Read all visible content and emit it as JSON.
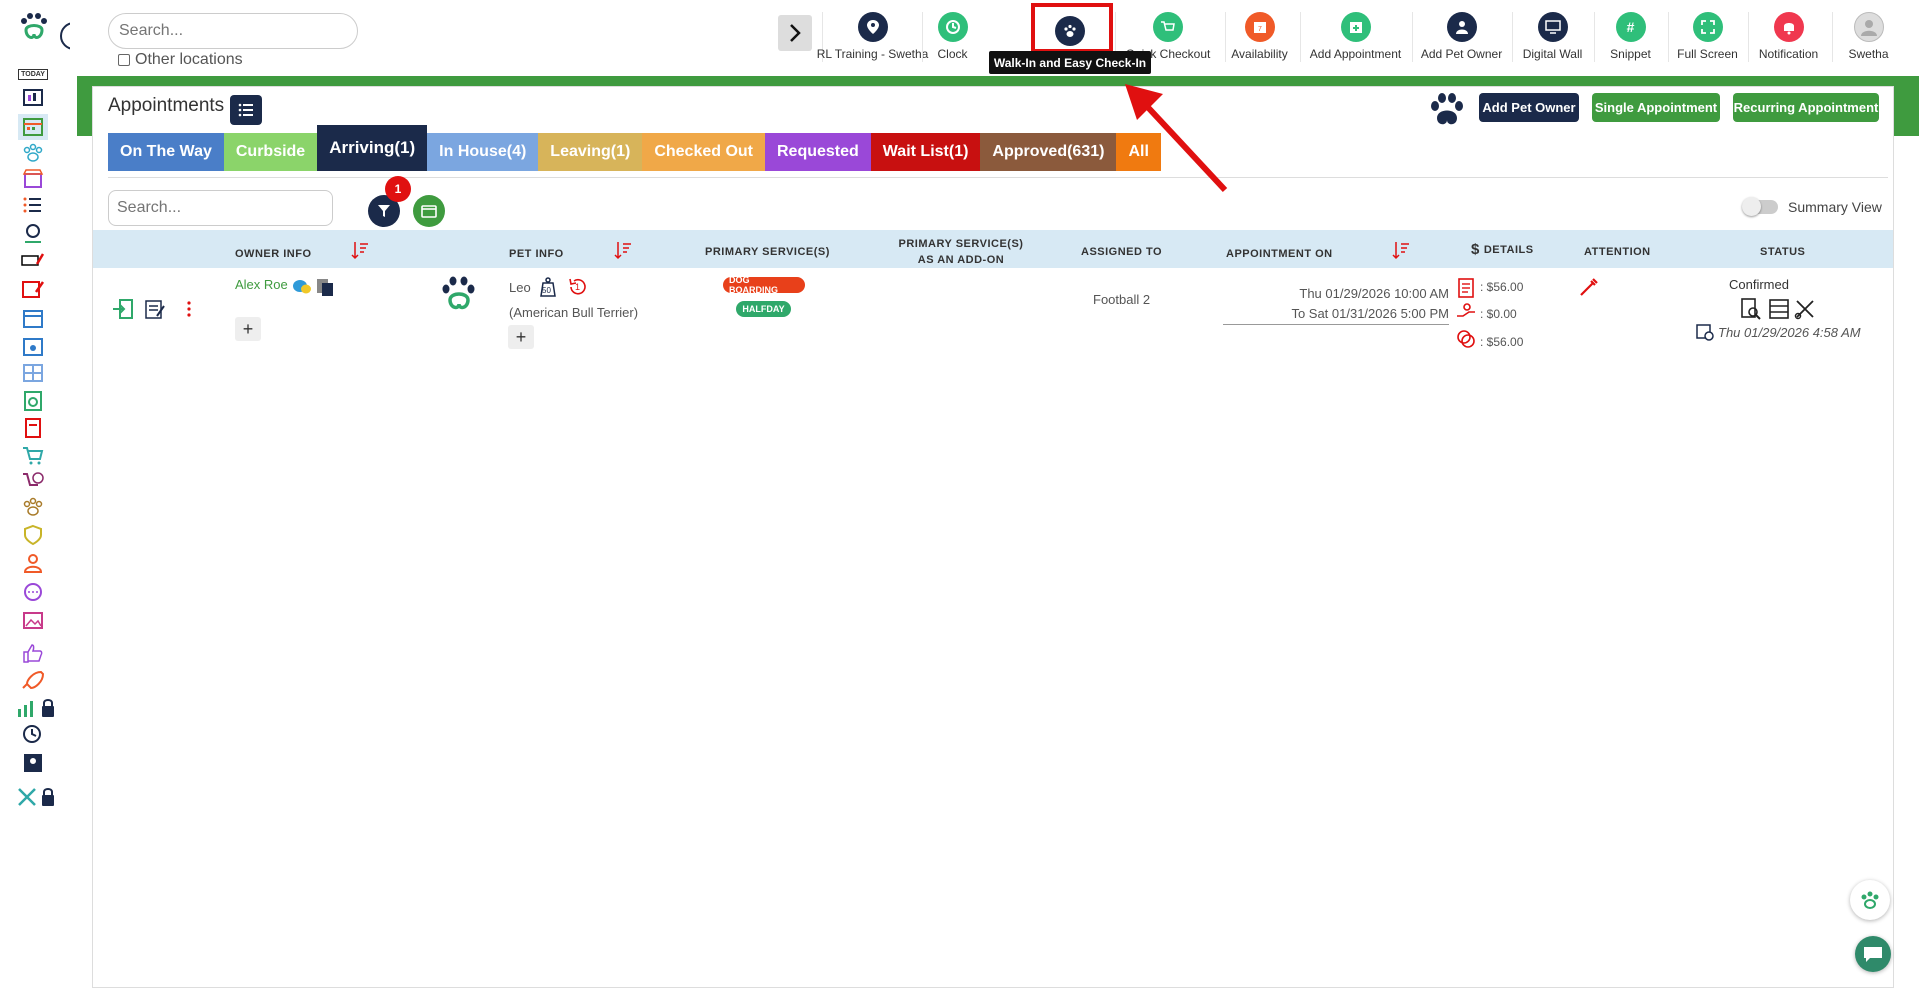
{
  "topbar": {
    "search_placeholder": "Search...",
    "other_locations": "Other locations",
    "items": [
      {
        "label": "RL Training - Swetha",
        "color": "#1b2a4a"
      },
      {
        "label": "Clock",
        "color": "#2fbf7a"
      },
      {
        "label": "",
        "color": "#1b2a4a"
      },
      {
        "label": "Quick Checkout",
        "color": "#2fbf7a"
      },
      {
        "label": "Availability",
        "color": "#f05a28"
      },
      {
        "label": "Add Appointment",
        "color": "#2fbf7a"
      },
      {
        "label": "Add Pet Owner",
        "color": "#1b2a4a"
      },
      {
        "label": "Digital Wall",
        "color": "#1b2a4a"
      },
      {
        "label": "Snippet",
        "color": "#2fbf7a"
      },
      {
        "label": "Full Screen",
        "color": "#2fbf7a"
      },
      {
        "label": "Notification",
        "color": "#f0384f"
      },
      {
        "label": "Swetha",
        "color": "#cccccc"
      }
    ],
    "tooltip": "Walk-In and Easy Check-In"
  },
  "appointments": {
    "title": "Appointments",
    "buttons": {
      "add_pet_owner": "Add Pet Owner",
      "single": "Single Appointment",
      "recurring": "Recurring Appointment"
    },
    "tabs": [
      {
        "label": "On The Way",
        "color": "#4a7ec8"
      },
      {
        "label": "Curbside",
        "color": "#8bd46a"
      },
      {
        "label": "Arriving(1)",
        "color": "#1b2a4a"
      },
      {
        "label": "In House(4)",
        "color": "#7ba6e0"
      },
      {
        "label": "Leaving(1)",
        "color": "#d7b45a"
      },
      {
        "label": "Checked Out",
        "color": "#f0a848"
      },
      {
        "label": "Requested",
        "color": "#9a48d8"
      },
      {
        "label": "Wait List(1)",
        "color": "#c81010"
      },
      {
        "label": "Approved(631)",
        "color": "#8b5a3c"
      },
      {
        "label": "All",
        "color": "#f07a10"
      }
    ],
    "search_placeholder": "Search...",
    "filter_count": "1",
    "summary_view": "Summary View"
  },
  "table": {
    "headers": {
      "owner": "OWNER INFO",
      "pet": "PET INFO",
      "primary": "PRIMARY SERVICE(S)",
      "addon_l1": "PRIMARY SERVICE(S)",
      "addon_l2": "AS AN ADD-ON",
      "assigned": "ASSIGNED TO",
      "appt_on": "APPOINTMENT ON",
      "details_dollar": "$",
      "details": "DETAILS",
      "attention": "ATTENTION",
      "status": "STATUS"
    },
    "row": {
      "owner_name": "Alex Roe",
      "pet_name": "Leo",
      "pet_weight": "50",
      "pet_count": "1",
      "pet_breed": "(American Bull Terrier)",
      "service1": "DOG BOARDING",
      "service2": "HALFDAY",
      "assigned": "Football 2",
      "appt_from": "Thu 01/29/2026 10:00 AM",
      "appt_to": "To Sat 01/31/2026 5:00 PM",
      "detail1": ": $56.00",
      "detail2": ": $0.00",
      "detail3": ": $56.00",
      "status": "Confirmed",
      "status_time": "Thu 01/29/2026 4:58 AM"
    }
  },
  "sidebar": {
    "today_label": "TODAY"
  }
}
